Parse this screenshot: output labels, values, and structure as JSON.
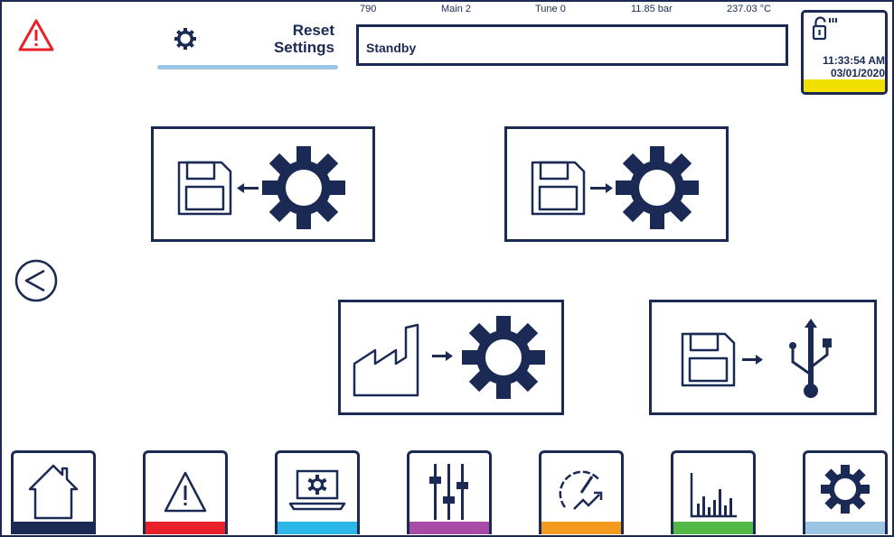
{
  "header": {
    "title_line1": "Reset",
    "title_line2": "Settings",
    "alarm_icon": "warning-triangle-icon",
    "settings_icon": "gear-icon"
  },
  "status": {
    "counter": "790",
    "mode": "Main 2",
    "tune": "Tune 0",
    "pressure": "11.85  bar",
    "temperature": "237.03 °C",
    "state": "Standby"
  },
  "clock": {
    "time": "11:33:54 AM",
    "date": "03/01/2020",
    "lock_icon": "unlock-signal-icon",
    "indicator_color": "#f2e100"
  },
  "actions": [
    {
      "name": "load-settings-from-memory",
      "icons": [
        "floppy-disk-icon",
        "arrow-left-icon",
        "gear-icon"
      ]
    },
    {
      "name": "save-settings-to-memory",
      "icons": [
        "floppy-disk-icon",
        "arrow-right-icon",
        "gear-icon"
      ]
    },
    {
      "name": "restore-factory-settings",
      "icons": [
        "factory-icon",
        "arrow-right-icon",
        "gear-icon"
      ]
    },
    {
      "name": "export-to-usb",
      "icons": [
        "floppy-disk-icon",
        "arrow-right-icon",
        "usb-icon"
      ]
    }
  ],
  "back_icon": "chevron-left-circle-icon",
  "bottom_nav": [
    {
      "icon": "home-icon",
      "color": "#1b2a55"
    },
    {
      "icon": "alarm-triangle-icon",
      "color": "#e8202a"
    },
    {
      "icon": "monitor-gear-icon",
      "color": "#2bb8e8"
    },
    {
      "icon": "sliders-icon",
      "color": "#a84aa6"
    },
    {
      "icon": "gauge-trend-icon",
      "color": "#f49a1e"
    },
    {
      "icon": "bar-chart-icon",
      "color": "#53b848"
    },
    {
      "icon": "gear-icon",
      "color": "#9cc4e4"
    }
  ],
  "colors": {
    "primary": "#1b2a55",
    "alarm": "#e8202a"
  }
}
